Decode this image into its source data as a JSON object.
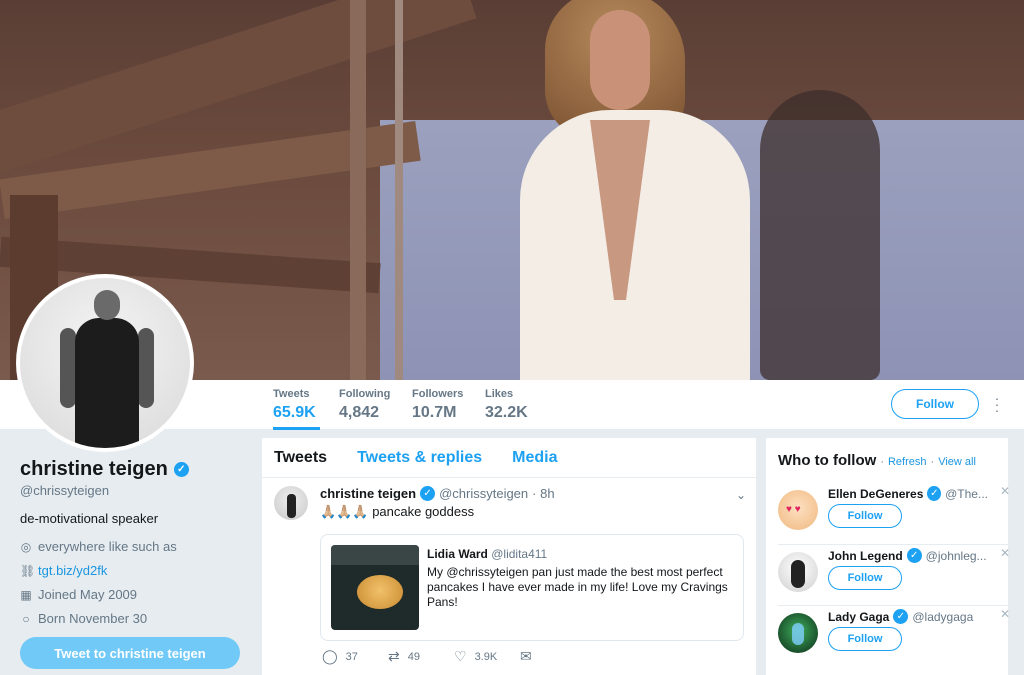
{
  "profile": {
    "name": "christine teigen",
    "handle": "@chrissyteigen",
    "bio": "de-motivational speaker",
    "location": "everywhere like such as",
    "website": "tgt.biz/yd2fk",
    "joined": "Joined May 2009",
    "born": "Born November 30",
    "tweet_to_label": "Tweet to christine teigen"
  },
  "stats": [
    {
      "label": "Tweets",
      "value": "65.9K"
    },
    {
      "label": "Following",
      "value": "4,842"
    },
    {
      "label": "Followers",
      "value": "10.7M"
    },
    {
      "label": "Likes",
      "value": "32.2K"
    }
  ],
  "header": {
    "follow_label": "Follow",
    "more_icon": "more-vertical-icon"
  },
  "timeline": {
    "tabs": [
      "Tweets",
      "Tweets & replies",
      "Media"
    ],
    "tweet": {
      "name": "christine teigen",
      "handle": "@chrissyteigen",
      "time": "· 8h",
      "emoji": "🙏🏼🙏🏼🙏🏼",
      "text": "pancake goddess",
      "quote": {
        "name": "Lidia Ward",
        "handle": "@lidita411",
        "text": "My @chrissyteigen pan just made the best most perfect pancakes I have ever made in my life! Love my Cravings Pans!"
      },
      "actions": {
        "replies": "37",
        "retweets": "49",
        "likes": "3.9K"
      }
    }
  },
  "who_to_follow": {
    "title": "Who to follow",
    "refresh": "Refresh",
    "separator": "·",
    "view_all": "View all",
    "follow_label": "Follow",
    "suggestions": [
      {
        "name": "Ellen DeGeneres",
        "handle": "@The..."
      },
      {
        "name": "John Legend",
        "handle": "@johnleg..."
      },
      {
        "name": "Lady Gaga",
        "handle": "@ladygaga"
      }
    ]
  },
  "colors": {
    "accent": "#1da1f2",
    "background": "#e6ecf0",
    "text": "#14171a",
    "muted": "#657786"
  }
}
